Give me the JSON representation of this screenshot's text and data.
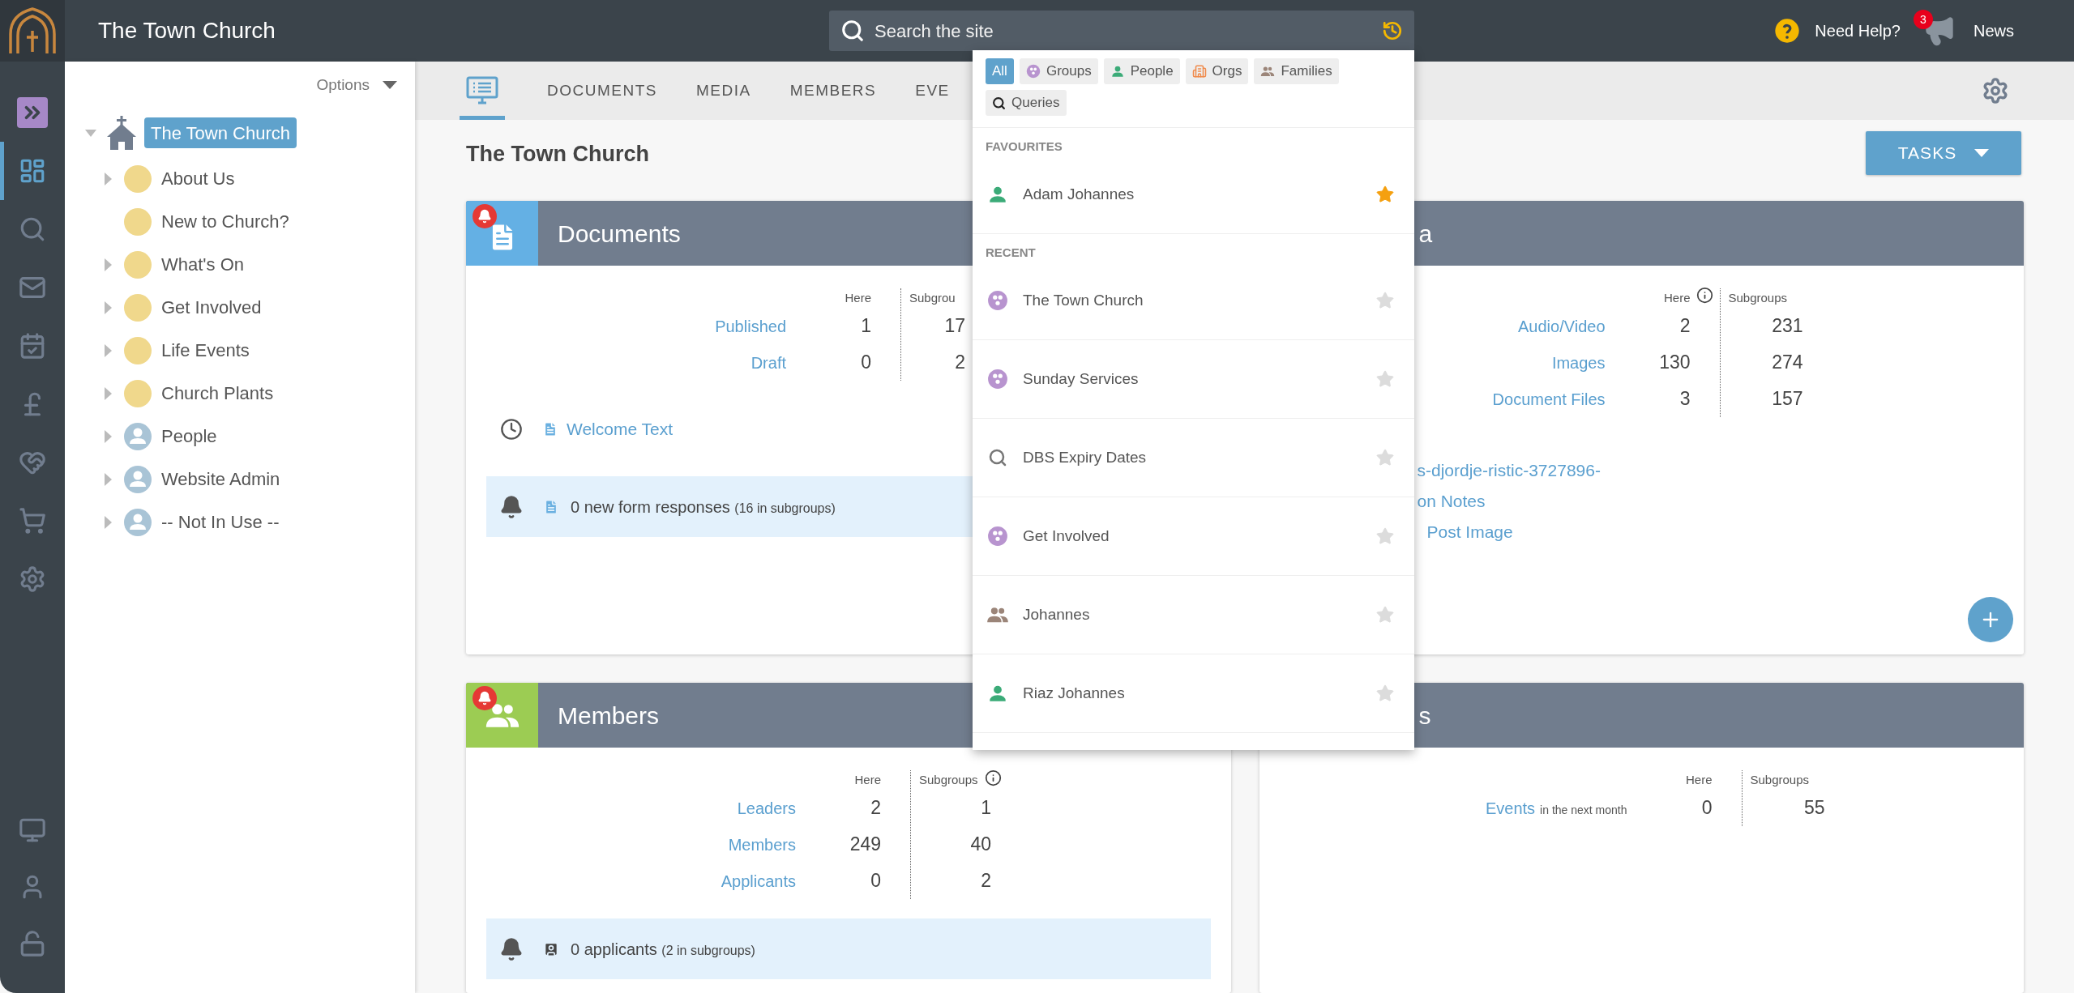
{
  "topbar": {
    "title": "The Town Church",
    "search": {
      "placeholder": "Search the site"
    },
    "help": "Need Help?",
    "news": {
      "label": "News",
      "badge": "3"
    }
  },
  "rail": [
    {
      "kind": "expand",
      "selected": false
    },
    {
      "kind": "dashboard",
      "selected": true
    },
    {
      "kind": "search",
      "selected": false
    },
    {
      "kind": "mail",
      "selected": false
    },
    {
      "kind": "calendar",
      "selected": false
    },
    {
      "kind": "finance",
      "selected": false
    },
    {
      "kind": "giving",
      "selected": false
    },
    {
      "kind": "shop",
      "selected": false
    },
    {
      "kind": "settings",
      "selected": false
    }
  ],
  "rail_bottom": [
    {
      "kind": "display",
      "selected": false
    },
    {
      "kind": "account",
      "selected": false
    },
    {
      "kind": "lock",
      "selected": false
    }
  ],
  "tree": {
    "options": "Options",
    "root": {
      "label": "The Town Church",
      "expanded": true,
      "selected": true,
      "children": [
        {
          "label": "About Us",
          "kind": "group",
          "expandable": true
        },
        {
          "label": "New to Church?",
          "kind": "group",
          "expandable": false
        },
        {
          "label": "What's On",
          "kind": "group",
          "expandable": true
        },
        {
          "label": "Get Involved",
          "kind": "group",
          "expandable": true
        },
        {
          "label": "Life Events",
          "kind": "group",
          "expandable": true
        },
        {
          "label": "Church Plants",
          "kind": "group",
          "expandable": true
        },
        {
          "label": "People",
          "kind": "person",
          "expandable": true
        },
        {
          "label": "Website Admin",
          "kind": "person",
          "expandable": true
        },
        {
          "label": "-- Not In Use --",
          "kind": "person",
          "expandable": true
        }
      ]
    }
  },
  "tabs": [
    {
      "kind": "icon",
      "selected": true
    },
    {
      "kind": "text",
      "label": "DOCUMENTS",
      "selected": false
    },
    {
      "kind": "text",
      "label": "MEDIA",
      "selected": false
    },
    {
      "kind": "text",
      "label": "MEMBERS",
      "selected": false
    },
    {
      "kind": "text",
      "label": "EVE",
      "selected": false
    }
  ],
  "page": {
    "title": "The Town Church",
    "tasks": "TASKS"
  },
  "cards": [
    {
      "kind": "documents",
      "title": "Documents",
      "alert": true,
      "stats": {
        "here": "Here",
        "subgroups": "Subgrou",
        "rows": [
          {
            "label": "Published",
            "here": "1",
            "subgroups": "17"
          },
          {
            "label": "Draft",
            "here": "0",
            "subgroups": "2"
          }
        ]
      },
      "recent": [
        "Welcome Text"
      ],
      "notice": {
        "kind": "form",
        "text": "0 new form responses",
        "note": "(16 in subgroups)"
      }
    },
    {
      "kind": "media",
      "title": "a",
      "stats": {
        "here": "Here",
        "subgroups": "Subgroups",
        "here_info": true,
        "rows": [
          {
            "label": "Audio/Video",
            "here": "2",
            "subgroups": "231"
          },
          {
            "label": "Images",
            "here": "130",
            "subgroups": "274"
          },
          {
            "label": "Document Files",
            "here": "3",
            "subgroups": "157"
          }
        ]
      },
      "links": [
        "s-djordje-ristic-3727896-",
        "on Notes",
        "Post Image"
      ],
      "add_button": true
    },
    {
      "kind": "members",
      "title": "Members",
      "alert": true,
      "stats": {
        "here": "Here",
        "subgroups": "Subgroups",
        "subgroups_info": true,
        "rows": [
          {
            "label": "Leaders",
            "here": "2",
            "subgroups": "1"
          },
          {
            "label": "Members",
            "here": "249",
            "subgroups": "40"
          },
          {
            "label": "Applicants",
            "here": "0",
            "subgroups": "2"
          }
        ]
      },
      "notice": {
        "kind": "applicant",
        "text": "0 applicants",
        "note": "(2 in subgroups)"
      }
    },
    {
      "kind": "events",
      "title": "s",
      "stats": {
        "here": "Here",
        "subgroups": "Subgroups",
        "rows": [
          {
            "label": "Events",
            "suffix": "in the next month",
            "here": "0",
            "subgroups": "55"
          }
        ]
      }
    }
  ],
  "search_dropdown": {
    "filters": [
      {
        "kind": "all",
        "label": "All",
        "selected": true
      },
      {
        "kind": "group",
        "label": "Groups",
        "selected": false
      },
      {
        "kind": "person",
        "label": "People",
        "selected": false
      },
      {
        "kind": "org",
        "label": "Orgs",
        "selected": false
      },
      {
        "kind": "family",
        "label": "Families",
        "selected": false
      },
      {
        "kind": "query",
        "label": "Queries",
        "selected": false
      }
    ],
    "sections": [
      {
        "heading": "FAVOURITES",
        "items": [
          {
            "kind": "person",
            "label": "Adam Johannes",
            "starred": true
          }
        ]
      },
      {
        "heading": "RECENT",
        "items": [
          {
            "kind": "group",
            "label": "The Town Church",
            "starred": false
          },
          {
            "kind": "group",
            "label": "Sunday Services",
            "starred": false
          },
          {
            "kind": "query",
            "label": "DBS Expiry Dates",
            "starred": false
          },
          {
            "kind": "group",
            "label": "Get Involved",
            "starred": false
          },
          {
            "kind": "family",
            "label": "Johannes",
            "starred": false
          },
          {
            "kind": "person",
            "label": "Riaz Johannes",
            "starred": false
          }
        ]
      }
    ]
  }
}
